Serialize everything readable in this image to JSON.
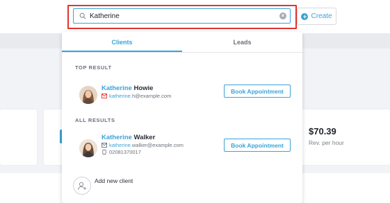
{
  "search": {
    "value": "Katherine",
    "icon": "search-icon",
    "clear_icon": "clear-icon"
  },
  "header": {
    "create_label": "Create",
    "create_icon": "plus-circle-icon"
  },
  "dropdown": {
    "tabs": [
      {
        "label": "Clients",
        "active": true
      },
      {
        "label": "Leads",
        "active": false
      }
    ],
    "top_result": {
      "section_title": "TOP RESULT",
      "first_name": "Katherine",
      "last_name": " Howie",
      "email_match": "katherine",
      "email_rest": ".h@example.com",
      "action_label": "Book Appointment"
    },
    "all_results": {
      "section_title": "ALL RESULTS",
      "items": [
        {
          "first_name": "Katherine",
          "last_name": " Walker",
          "email_match": "katherine",
          "email_rest": ".walker@example.com",
          "phone": "02081370017",
          "action_label": "Book Appointment"
        }
      ]
    },
    "add_new_label": "Add new client"
  },
  "background": {
    "rev_value": "$70.39",
    "rev_label": "Rev. per hour"
  },
  "colors": {
    "accent": "#3aa3d6",
    "highlight_border": "#e0322e"
  }
}
